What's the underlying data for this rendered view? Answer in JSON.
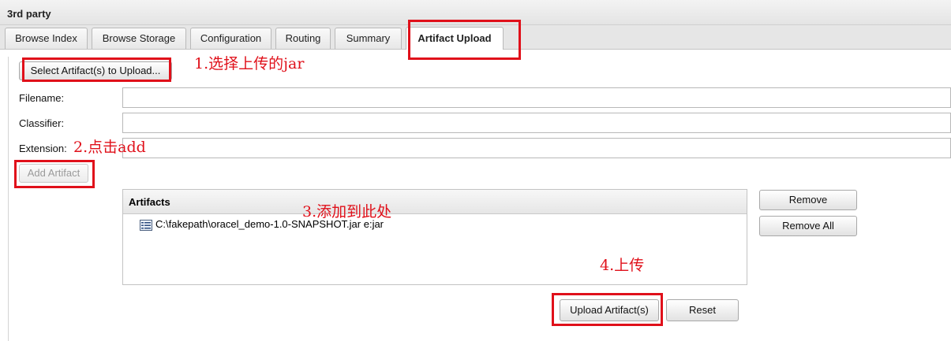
{
  "panel": {
    "title": "3rd party"
  },
  "tabs": [
    {
      "label": "Browse Index"
    },
    {
      "label": "Browse Storage"
    },
    {
      "label": "Configuration"
    },
    {
      "label": "Routing"
    },
    {
      "label": "Summary"
    },
    {
      "label": "Artifact Upload",
      "active": true
    }
  ],
  "upload_form": {
    "select_button": "Select Artifact(s) to Upload...",
    "filename_label": "Filename:",
    "filename_value": "",
    "classifier_label": "Classifier:",
    "classifier_value": "",
    "extension_label": "Extension:",
    "extension_value": "",
    "add_artifact_button": "Add Artifact"
  },
  "artifacts": {
    "header": "Artifacts",
    "items": [
      {
        "label": "C:\\fakepath\\oracel_demo-1.0-SNAPSHOT.jar e:jar",
        "icon": "file-list-icon"
      }
    ],
    "remove_button": "Remove",
    "remove_all_button": "Remove All"
  },
  "actions": {
    "upload_button": "Upload Artifact(s)",
    "reset_button": "Reset"
  },
  "annotations": {
    "step1": "1.选择上传的jar",
    "step2": "2.点击add",
    "step3": "3.添加到此处",
    "step4": "4.上传",
    "color": "#e0101a"
  }
}
